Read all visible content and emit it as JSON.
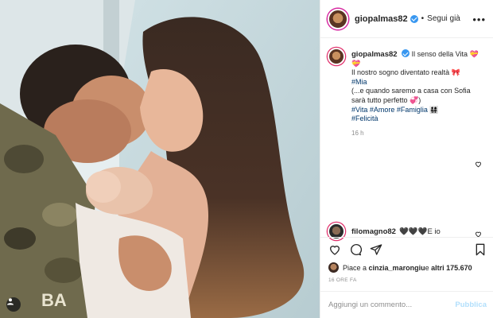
{
  "post": {
    "username": "giopalmas82",
    "follow_label": "Segui già",
    "dot": "•"
  },
  "caption": {
    "username": "giopalmas82",
    "line1": "Il senso della Vita 💝",
    "line2": "💝",
    "line3": "Il nostro sogno diventato realtà 🎀",
    "line4": "#Mia",
    "line5": "(...e quando saremo a casa con Sofia",
    "line6": "sarà tutto perfetto 💞)",
    "line7": "#Vita #Amore #Famiglia 👨‍👩‍👧‍👧",
    "line8": "#Felicità",
    "time": "16 h"
  },
  "comment": {
    "username": "filomagno82",
    "text": "🖤🖤🖤E io"
  },
  "likes": {
    "prefix": "Piace a ",
    "user": "cinzia_marongiu",
    "middle": " e ",
    "others": "altri 175.670"
  },
  "date": "16 ORE FA",
  "add_comment": {
    "placeholder": "Aggiungi un commento...",
    "publish_label": "Pubblica"
  },
  "colors": {
    "link_blue": "#00376b",
    "verified": "#3897f0",
    "publish_disabled": "#b2dffc"
  },
  "icons": [
    "more-icon",
    "heart-icon",
    "comment-icon",
    "share-icon",
    "bookmark-icon",
    "verified-icon",
    "tag-users-icon"
  ]
}
